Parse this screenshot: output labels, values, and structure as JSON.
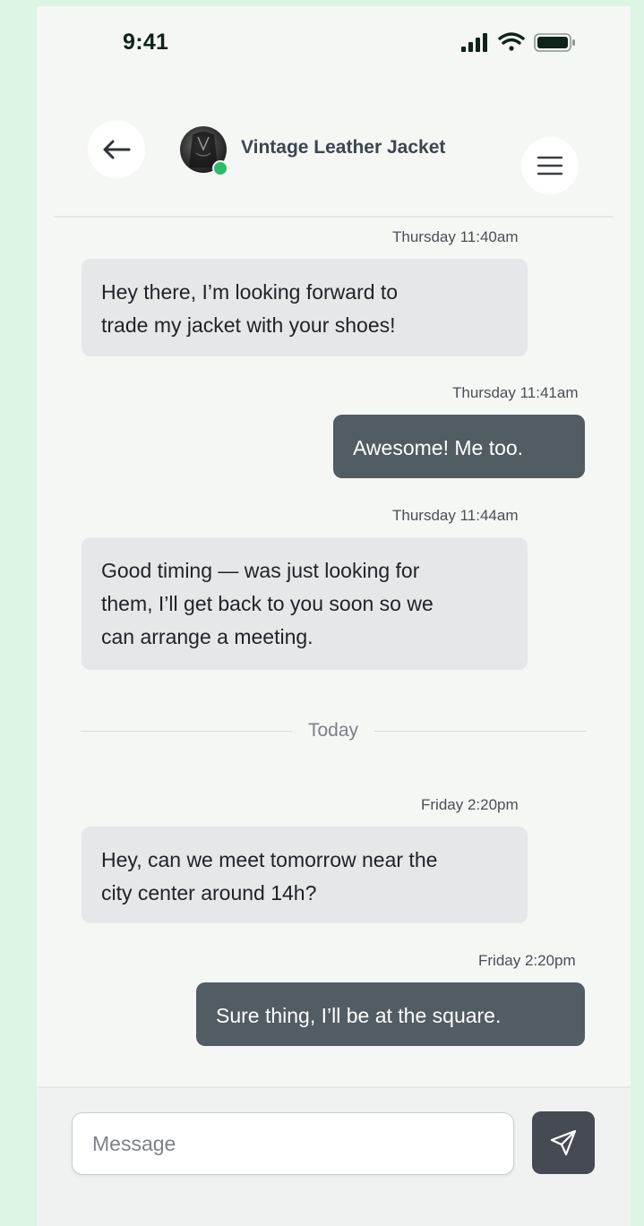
{
  "status_bar": {
    "time": "9:41",
    "icons": [
      "signal-icon",
      "wifi-icon",
      "battery-icon"
    ]
  },
  "header": {
    "back_icon": "arrow-left-icon",
    "title": "Vintage Leather Jacket",
    "menu_icon": "hamburger-menu-icon",
    "online_color": "#2bbd6a"
  },
  "messages": [
    {
      "direction": "incoming",
      "timestamp": "Thursday 11:40am",
      "lines": [
        "Hey there, I’m looking forward to",
        "trade my jacket with your shoes!"
      ]
    },
    {
      "direction": "outgoing",
      "timestamp": "Thursday 11:41am",
      "lines": [
        "Awesome! Me too."
      ]
    },
    {
      "direction": "incoming",
      "timestamp": "Thursday 11:44am",
      "lines": [
        "Good timing — was just looking for",
        "them, I’ll get back to you soon so we",
        "can arrange a meeting."
      ]
    },
    {
      "direction": "incoming",
      "timestamp": "Friday 2:20pm",
      "lines": [
        "Hey, can we meet tomorrow near the",
        "city center around 14h?"
      ]
    },
    {
      "direction": "outgoing",
      "timestamp": "Friday 2:20pm",
      "lines": [
        "Sure thing, I’ll be at the square."
      ]
    }
  ],
  "day_separator": "Today",
  "composer": {
    "placeholder": "Message",
    "value": "",
    "send_icon": "send-icon"
  },
  "colors": {
    "background": "#dcf5e4",
    "screen": "#f5f7f5",
    "incoming_bubble": "#e6e7e9",
    "outgoing_bubble": "#525c63",
    "send_button": "#464a52"
  }
}
